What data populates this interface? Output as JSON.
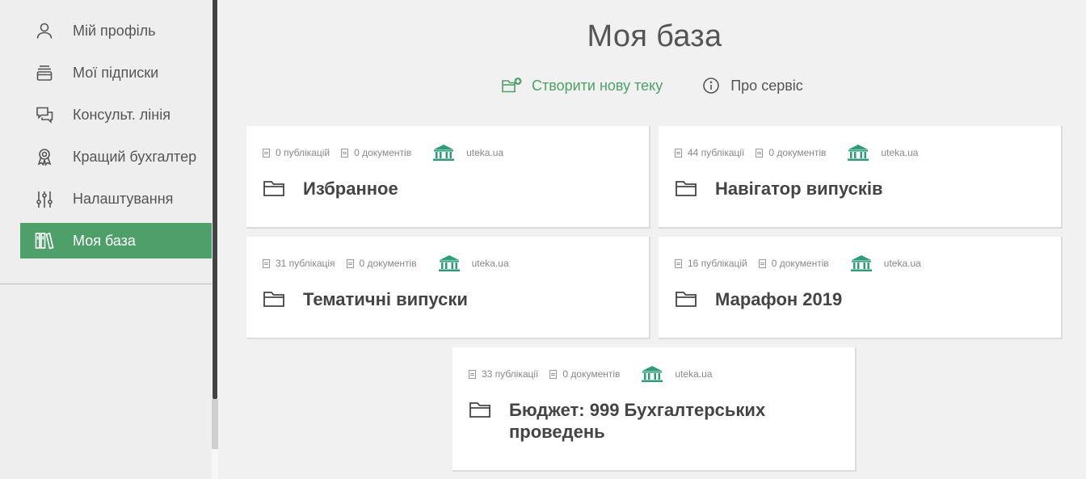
{
  "sidebar": {
    "items": [
      {
        "label": "Мій профіль",
        "icon": "user-icon"
      },
      {
        "label": "Мої підписки",
        "icon": "subscriptions-icon"
      },
      {
        "label": "Консульт. лінія",
        "icon": "chat-icon"
      },
      {
        "label": "Кращий бухгалтер",
        "icon": "award-icon"
      },
      {
        "label": "Налаштування",
        "icon": "sliders-icon"
      },
      {
        "label": "Моя база",
        "icon": "library-icon",
        "active": true
      }
    ]
  },
  "main": {
    "title": "Моя база",
    "actions": {
      "create": "Створити нову теку",
      "about": "Про сервіс"
    },
    "cards": [
      {
        "publications": "0 публікацій",
        "documents": "0 документів",
        "source": "uteka.ua",
        "title": "Избранное"
      },
      {
        "publications": "44 публікації",
        "documents": "0 документів",
        "source": "uteka.ua",
        "title": "Навігатор випусків"
      },
      {
        "publications": "31 публікація",
        "documents": "0 документів",
        "source": "uteka.ua",
        "title": "Тематичні випуски"
      },
      {
        "publications": "16 публікацій",
        "documents": "0 документів",
        "source": "uteka.ua",
        "title": "Марафон 2019"
      },
      {
        "publications": "33 публікації",
        "documents": "0 документів",
        "source": "uteka.ua",
        "title": "Бюджет: 999 Бухгалтерських проведень"
      }
    ]
  },
  "colors": {
    "accent": "#4f9f6a",
    "logo": "#2e9c7a"
  }
}
